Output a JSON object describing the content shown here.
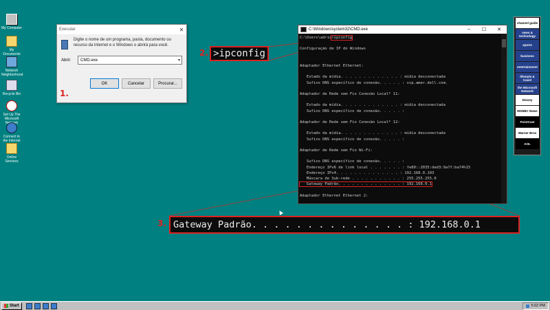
{
  "desktop": {
    "icons": [
      {
        "label": "My Computer",
        "icon": "computer-icon"
      },
      {
        "label": "My Documents",
        "icon": "folder-icon"
      },
      {
        "label": "Network Neighborhood",
        "icon": "network-icon"
      },
      {
        "label": "Recycle Bin",
        "icon": "recycle-bin-icon"
      },
      {
        "label": "Set Up The Microsoft Network",
        "icon": "msn-icon"
      },
      {
        "label": "Connect to the Internet",
        "icon": "internet-icon"
      },
      {
        "label": "Online Services",
        "icon": "folder-icon"
      }
    ]
  },
  "run_dialog": {
    "title": "Executar",
    "description": "Digite o nome de um programa, pasta, documento ou recurso da Internet e o Windows o abrirá para você.",
    "open_label": "Abrir:",
    "open_value": "CMD.exe",
    "ok_label": "OK",
    "cancel_label": "Cancelar",
    "browse_label": "Procurar..."
  },
  "steps": {
    "step1": "1.",
    "step2": "2.",
    "step3": "3."
  },
  "zoom": {
    "command": ">ipconfig",
    "gateway_line": "Gateway Padrão. . . . . . . . . . . . . . : 192.168.0.1"
  },
  "cmd_window": {
    "title": "C:\\Windows\\system32\\CMD.exe",
    "prompt_path": "C:\\Users\\adria",
    "prompt_command": ">ipconfig",
    "lines": [
      "",
      "Configuração de IP do Windows",
      "",
      "",
      "Adaptador Ethernet Ethernet:",
      "",
      "   Estado da mídia. . . . . . . . . . . . . : mídia desconectada",
      "   Sufixo DNS específico de conexão. . . . . : vcp.amer.dell.com.",
      "",
      "Adaptador de Rede sem Fio Conexão Local* 11:",
      "",
      "   Estado da mídia. . . . . . . . . . . . . : mídia desconectada",
      "   Sufixo DNS específico de conexão. . . . . :",
      "",
      "Adaptador de Rede sem Fio Conexão Local* 12:",
      "",
      "   Estado da mídia. . . . . . . . . . . . . : mídia desconectada",
      "   Sufixo DNS específico de conexão. . . . . :",
      "",
      "Adaptador de Rede sem Fio Wi-Fi:",
      "",
      "   Sufixo DNS específico de conexão. . . . . :",
      "   Endereço IPv6 de link local . . . . . . . : fe80::2035:ded3:9a7f:ba74%15",
      "   Endereço IPv4. . . . . . . . . . . . . . : 192.168.0.103",
      "   Máscara de Sub-rede . . . . . . . . . . . : 255.255.255.0"
    ],
    "gateway_line": "   Gateway Padrão. . . . . . . . . . . . . . : 192.168.0.1",
    "after_lines": [
      "",
      "Adaptador Ethernet Ethernet 2:"
    ]
  },
  "channel_bar": {
    "items": [
      "channel guide",
      "news & technology",
      "sports",
      "business",
      "entertainment",
      "lifestyle & travel",
      "the Microsoft Network",
      "Disney",
      "MSNBC News",
      "PointCast",
      "Warner Bros",
      "AOL"
    ]
  },
  "taskbar": {
    "start_label": "Start",
    "clock": "5:02 PM"
  }
}
